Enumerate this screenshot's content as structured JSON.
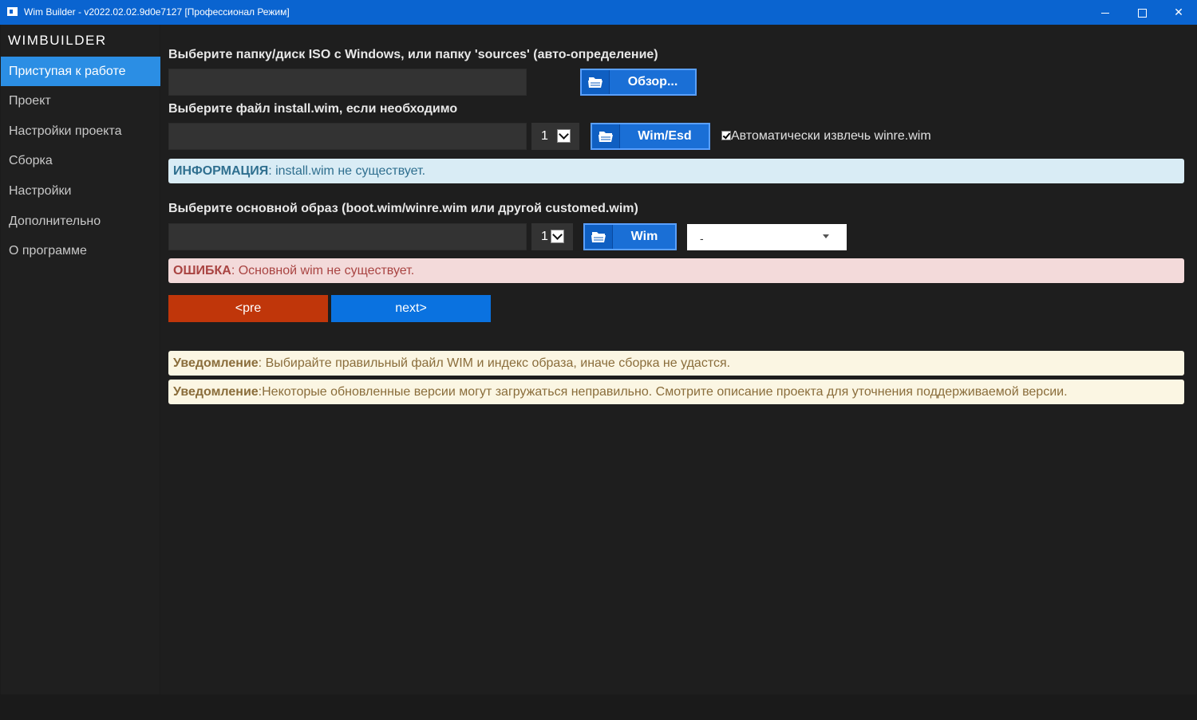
{
  "window": {
    "title": "Wim Builder - v2022.02.02.9d0e7127 [Профессионал Режим]",
    "close_glyph": "✕"
  },
  "sidebar": {
    "brand": "WIMBUILDER",
    "items": [
      {
        "label": "Приступая к работе",
        "active": true
      },
      {
        "label": "Проект"
      },
      {
        "label": "Настройки проекта"
      },
      {
        "label": "Сборка"
      },
      {
        "label": "Настройки"
      },
      {
        "label": "Дополнительно"
      },
      {
        "label": "О программе"
      }
    ]
  },
  "source": {
    "label": "Выберите папку/диск ISO с Windows, или папку 'sources' (авто-определение)",
    "path_value": "",
    "browse_label": "Обзор..."
  },
  "install_wim": {
    "label": "Выберите файл install.wim, если необходимо",
    "path_value": "",
    "index": "1",
    "browse_label": "Wim/Esd",
    "auto_extract_label": "Автоматически извлечь winre.wim",
    "auto_extract_checked": true
  },
  "info_alert": {
    "prefix": "ИНФОРМАЦИЯ",
    "text": ": install.wim не существует."
  },
  "base_image": {
    "label": "Выберите основной образ (boot.wim/winre.wim или другой customed.wim)",
    "path_value": "",
    "index": "1",
    "browse_label": "Wim",
    "combo_value": "-"
  },
  "error_alert": {
    "prefix": "ОШИБКА",
    "text": ": Основной wim не существует."
  },
  "navigation": {
    "pre_label": "<pre",
    "next_label": "next>"
  },
  "notices": [
    {
      "prefix": "Уведомление",
      "text": ": Выбирайте правильный файл WIM и индекс образа, иначе сборка не удастся."
    },
    {
      "prefix": "Уведомление",
      "text": ":Некоторые обновленные версии могут загружаться неправильно. Смотрите описание проекта для уточнения поддерживаемой версии."
    }
  ],
  "colors": {
    "titlebar": "#0a64d0",
    "sidebar_active": "#2b8ee4",
    "browse_button": "#1a6fd6",
    "pre_button": "#c0360a",
    "next_button": "#0a72e0",
    "info_bg": "#d9ecf5",
    "error_bg": "#f3dada",
    "notice_bg": "#fbf6e3"
  }
}
